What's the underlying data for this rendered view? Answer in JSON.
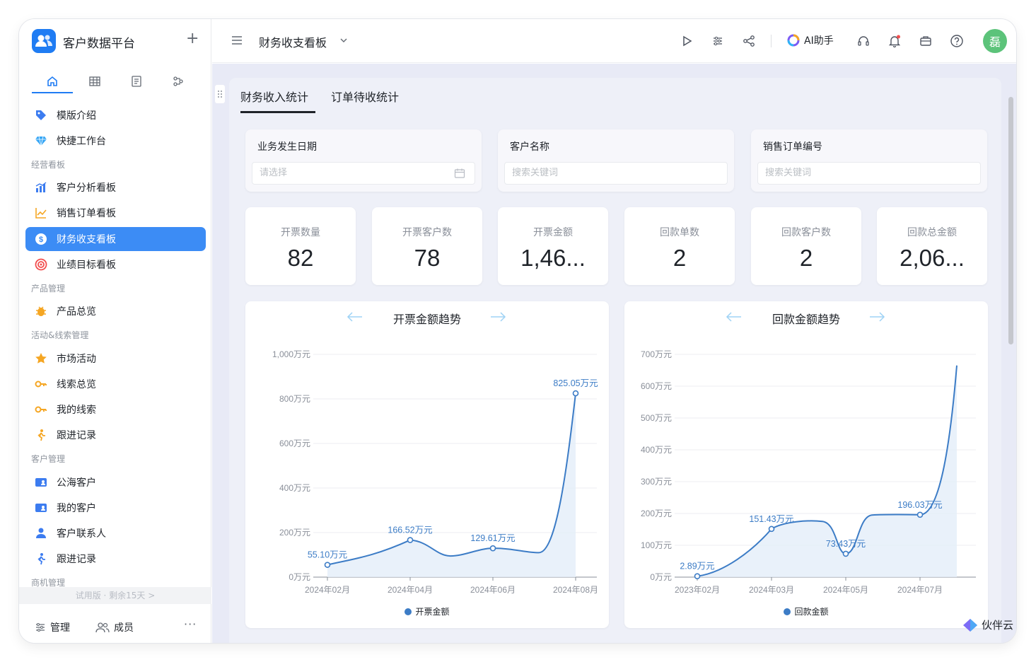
{
  "app": {
    "title": "客户数据平台",
    "add_label": "+"
  },
  "sidebar": {
    "tabs": [
      {
        "icon": "home-icon"
      },
      {
        "icon": "table-icon"
      },
      {
        "icon": "form-icon"
      },
      {
        "icon": "workflow-icon"
      }
    ],
    "items": [
      {
        "label": "模版介绍",
        "icon": "tag-icon",
        "color": "#3c7cf0"
      },
      {
        "label": "快捷工作台",
        "icon": "diamond-icon",
        "color": "#37a6f5"
      },
      {
        "label": "客户分析看板",
        "icon": "bar-chart-icon",
        "color": "#3c7cf0"
      },
      {
        "label": "销售订单看板",
        "icon": "trend-chart-icon",
        "color": "#f5a623"
      },
      {
        "label": "财务收支看板",
        "icon": "dollar-icon",
        "color": "#ffffff"
      },
      {
        "label": "业绩目标看板",
        "icon": "target-icon",
        "color": "#f24e4e"
      },
      {
        "label": "产品总览",
        "icon": "bug-icon",
        "color": "#f5a623"
      },
      {
        "label": "市场活动",
        "icon": "star-icon",
        "color": "#f5a623"
      },
      {
        "label": "线索总览",
        "icon": "key-icon",
        "color": "#f5a623"
      },
      {
        "label": "我的线索",
        "icon": "key-icon",
        "color": "#f5a623"
      },
      {
        "label": "跟进记录",
        "icon": "walk-icon",
        "color": "#f5a623"
      },
      {
        "label": "公海客户",
        "icon": "contact-card-icon",
        "color": "#3c7cf0"
      },
      {
        "label": "我的客户",
        "icon": "contact-card-icon",
        "color": "#3c7cf0"
      },
      {
        "label": "客户联系人",
        "icon": "person-icon",
        "color": "#3c7cf0"
      },
      {
        "label": "跟进记录",
        "icon": "walk-icon",
        "color": "#3c7cf0"
      }
    ],
    "groups": [
      "经营看板",
      "产品管理",
      "活动&线索管理",
      "客户管理",
      "商机管理"
    ],
    "trial": "试用版 · 剩余15天  >",
    "footer": {
      "manage": "管理",
      "members": "成员",
      "more": "···"
    }
  },
  "header": {
    "title": "财务收支看板",
    "ai_label": "AI助手",
    "avatar": "磊",
    "icons": [
      "play-icon",
      "filter-settings-icon",
      "share-icon",
      "headset-icon",
      "bell-icon",
      "briefcase-icon",
      "help-icon"
    ]
  },
  "panel": {
    "tabs": [
      "财务收入统计",
      "订单待收统计"
    ],
    "filters": [
      {
        "label": "业务发生日期",
        "placeholder": "请选择"
      },
      {
        "label": "客户名称",
        "placeholder": "搜索关键词"
      },
      {
        "label": "销售订单编号",
        "placeholder": "搜索关键词"
      }
    ],
    "stats": [
      {
        "label": "开票数量",
        "value": "82"
      },
      {
        "label": "开票客户数",
        "value": "78"
      },
      {
        "label": "开票金额",
        "value": "1,46..."
      },
      {
        "label": "回款单数",
        "value": "2"
      },
      {
        "label": "回款客户数",
        "value": "2"
      },
      {
        "label": "回款总金额",
        "value": "2,06..."
      }
    ]
  },
  "chart_data": [
    {
      "type": "area",
      "title": "开票金额趋势",
      "unit": "万元",
      "series": [
        {
          "name": "开票金额",
          "color": "#3c7cc6"
        }
      ],
      "x": [
        "2024年02月",
        "2024年04月",
        "2024年06月",
        "2024年08月"
      ],
      "y_ticks": [
        "0万元",
        "200万元",
        "400万元",
        "600万元",
        "800万元",
        "1,000万元"
      ],
      "ylim": [
        0,
        1000
      ],
      "points": [
        {
          "x": "2024年02月",
          "value": 55.1,
          "label": "55.10万元"
        },
        {
          "x": "2024年04月",
          "value": 166.52,
          "label": "166.52万元"
        },
        {
          "x": "2024年06月",
          "value": 129.61,
          "label": "129.61万元"
        },
        {
          "x": "2024年08月",
          "value": 825.05,
          "label": "825.05万元"
        }
      ]
    },
    {
      "type": "area",
      "title": "回款金额趋势",
      "unit": "万元",
      "series": [
        {
          "name": "回款金额",
          "color": "#3c7cc6"
        }
      ],
      "x": [
        "2023年02月",
        "2024年03月",
        "2024年05月",
        "2024年07月"
      ],
      "y_ticks": [
        "0万元",
        "100万元",
        "200万元",
        "300万元",
        "400万元",
        "500万元",
        "600万元",
        "700万元"
      ],
      "ylim": [
        0,
        700
      ],
      "points": [
        {
          "x": "2023年02月",
          "value": 2.89,
          "label": "2.89万元"
        },
        {
          "x": "2024年03月",
          "value": 151.43,
          "label": "151.43万元"
        },
        {
          "x": "2024年05月",
          "value": 73.43,
          "label": "73.43万元"
        },
        {
          "x": "2024年07月",
          "value": 196.03,
          "label": "196.03万元"
        }
      ]
    }
  ],
  "watermark": "伙伴云"
}
